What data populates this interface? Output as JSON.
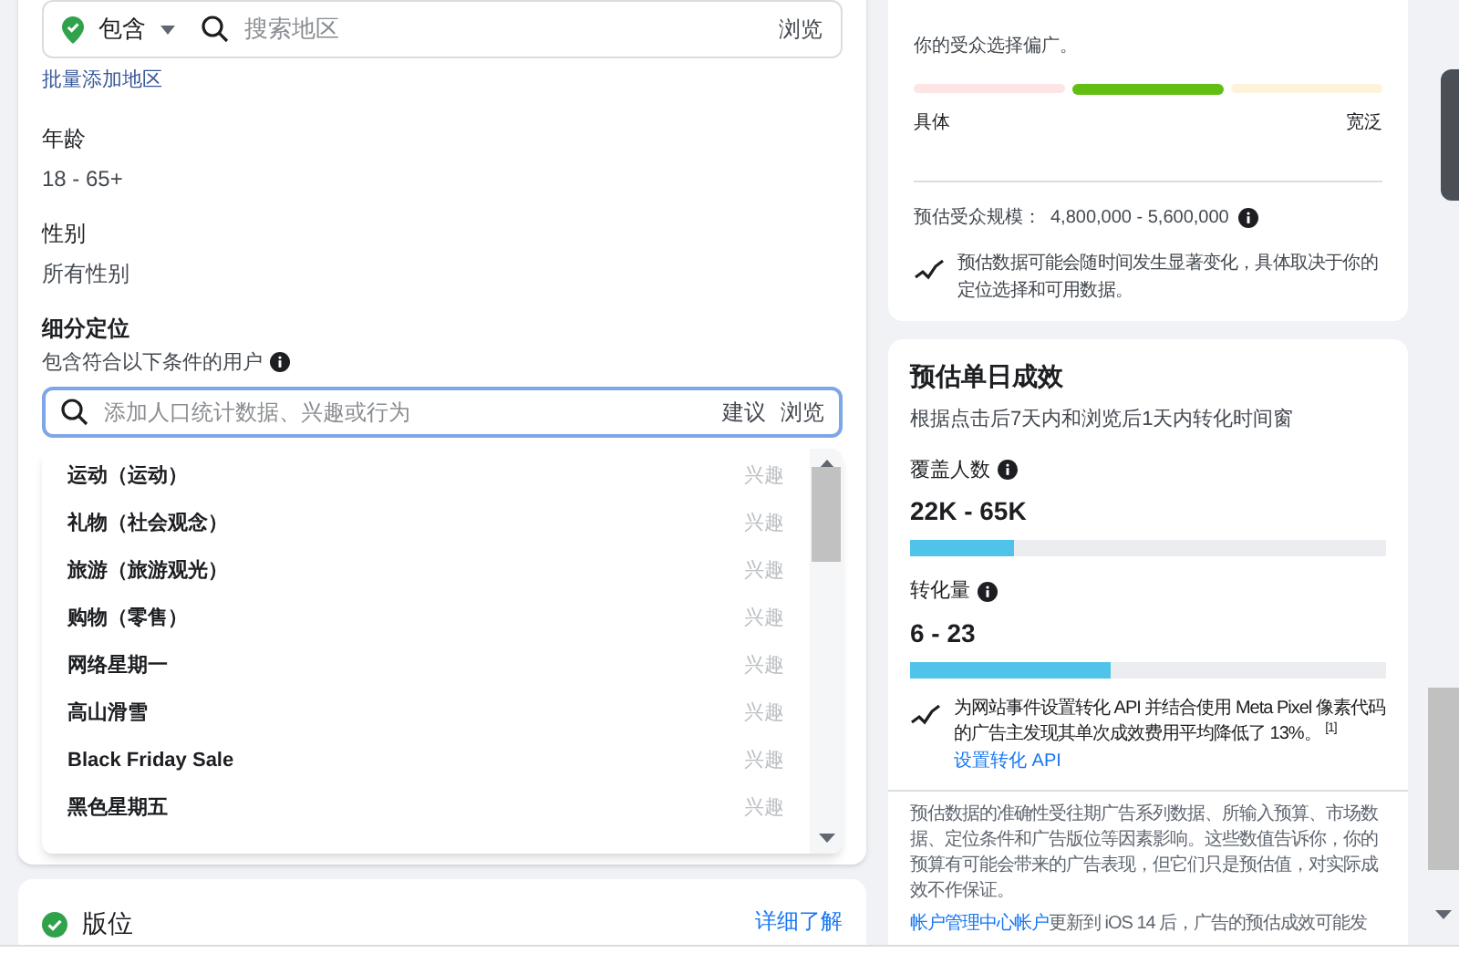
{
  "location": {
    "mode": "包含",
    "placeholder": "搜索地区",
    "browse": "浏览",
    "bulk_link": "批量添加地区"
  },
  "age": {
    "label": "年龄",
    "value": "18 - 65+"
  },
  "gender": {
    "label": "性别",
    "value": "所有性别"
  },
  "detailed_targeting": {
    "label": "细分定位",
    "subtitle": "包含符合以下条件的用户",
    "placeholder": "添加人口统计数据、兴趣或行为",
    "suggest": "建议",
    "browse": "浏览",
    "options": [
      {
        "label": "运动（运动）",
        "type": "兴趣"
      },
      {
        "label": "礼物（社会观念）",
        "type": "兴趣"
      },
      {
        "label": "旅游（旅游观光）",
        "type": "兴趣"
      },
      {
        "label": "购物（零售）",
        "type": "兴趣"
      },
      {
        "label": "网络星期一",
        "type": "兴趣"
      },
      {
        "label": "高山滑雪",
        "type": "兴趣"
      },
      {
        "label": "Black Friday Sale",
        "type": "兴趣"
      },
      {
        "label": "黑色星期五",
        "type": "兴趣"
      }
    ]
  },
  "placements": {
    "title": "版位",
    "link": "详细了解"
  },
  "audience": {
    "summary": "你的受众选择偏广。",
    "segments": [
      {
        "selected": false,
        "color": "#fbe0df"
      },
      {
        "selected": true,
        "color": "#63be14"
      },
      {
        "selected": false,
        "color": "#fdf0d3"
      }
    ],
    "left_label": "具体",
    "right_label": "宽泛",
    "size_label": "预估受众规模：",
    "size_value": "4,800,000 - 5,600,000",
    "note": "预估数据可能会随时间发生显著变化，具体取决于你的定位选择和可用数据。"
  },
  "daily_results": {
    "title": "预估单日成效",
    "subtitle": "根据点击后7天内和浏览后1天内转化时间窗",
    "metrics": [
      {
        "label": "覆盖人数",
        "value": "22K - 65K",
        "level": 0.22
      },
      {
        "label": "转化量",
        "value": "6 - 23",
        "level": 0.42
      }
    ],
    "tip": "为网站事件设置转化 API 并结合使用 Meta Pixel 像素代码的广告主发现其单次成效费用平均降低了 13%。",
    "tip_ref": "[1]",
    "tip_link": "设置转化 API",
    "disclaimer": "预估数据的准确性受往期广告系列数据、所输入预算、市场数据、定位条件和广告版位等因素影响。这些数值告诉你，你的预算有可能会带来的广告表现，但它们只是预估值，对实际成效不作保证。",
    "ios_link": "帐户管理中心帐户",
    "ios_text": "更新到 iOS 14 后，广告的预估成效可能发"
  }
}
